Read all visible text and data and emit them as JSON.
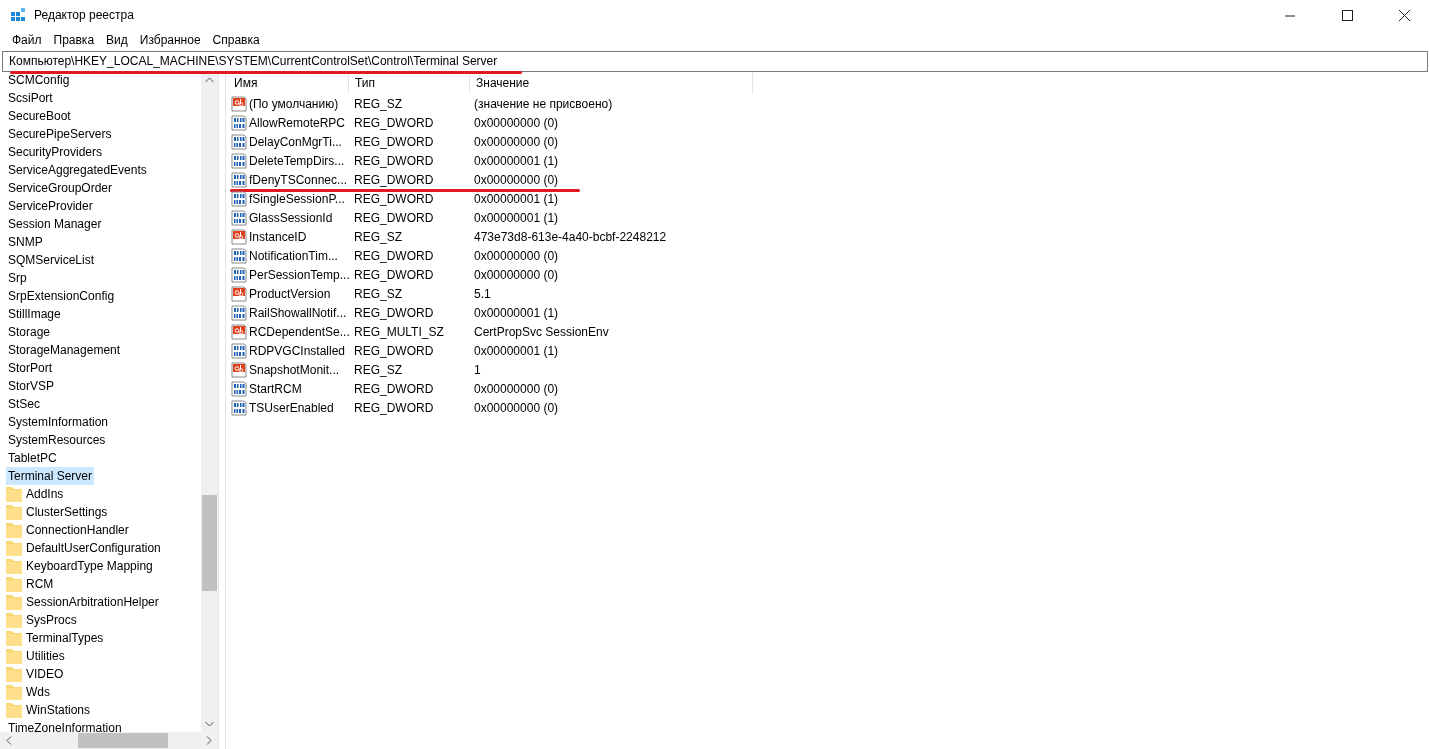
{
  "window": {
    "title": "Редактор реестра"
  },
  "menu": [
    "Файл",
    "Правка",
    "Вид",
    "Избранное",
    "Справка"
  ],
  "address": {
    "value": "Компьютер\\HKEY_LOCAL_MACHINE\\SYSTEM\\CurrentControlSet\\Control\\Terminal Server",
    "underlined": true
  },
  "tree": [
    {
      "label": "SCMConfig",
      "selected": false
    },
    {
      "label": "ScsiPort",
      "selected": false
    },
    {
      "label": "SecureBoot",
      "selected": false
    },
    {
      "label": "SecurePipeServers",
      "selected": false
    },
    {
      "label": "SecurityProviders",
      "selected": false
    },
    {
      "label": "ServiceAggregatedEvents",
      "selected": false
    },
    {
      "label": "ServiceGroupOrder",
      "selected": false
    },
    {
      "label": "ServiceProvider",
      "selected": false
    },
    {
      "label": "Session Manager",
      "selected": false
    },
    {
      "label": "SNMP",
      "selected": false
    },
    {
      "label": "SQMServiceList",
      "selected": false
    },
    {
      "label": "Srp",
      "selected": false
    },
    {
      "label": "SrpExtensionConfig",
      "selected": false
    },
    {
      "label": "StillImage",
      "selected": false
    },
    {
      "label": "Storage",
      "selected": false
    },
    {
      "label": "StorageManagement",
      "selected": false
    },
    {
      "label": "StorPort",
      "selected": false
    },
    {
      "label": "StorVSP",
      "selected": false
    },
    {
      "label": "StSec",
      "selected": false
    },
    {
      "label": "SystemInformation",
      "selected": false
    },
    {
      "label": "SystemResources",
      "selected": false
    },
    {
      "label": "TabletPC",
      "selected": false
    },
    {
      "label": "Terminal Server",
      "selected": true,
      "children": [
        {
          "label": "AddIns",
          "selected": false
        },
        {
          "label": "ClusterSettings",
          "selected": false
        },
        {
          "label": "ConnectionHandler",
          "selected": false
        },
        {
          "label": "DefaultUserConfiguration",
          "selected": false
        },
        {
          "label": "KeyboardType Mapping",
          "selected": false
        },
        {
          "label": "RCM",
          "selected": false
        },
        {
          "label": "SessionArbitrationHelper",
          "selected": false
        },
        {
          "label": "SysProcs",
          "selected": false
        },
        {
          "label": "TerminalTypes",
          "selected": false
        },
        {
          "label": "Utilities",
          "selected": false
        },
        {
          "label": "VIDEO",
          "selected": false
        },
        {
          "label": "Wds",
          "selected": false
        },
        {
          "label": "WinStations",
          "selected": false
        }
      ]
    },
    {
      "label": "TimeZoneInformation",
      "selected": false
    }
  ],
  "columns": [
    "Имя",
    "Тип",
    "Значение"
  ],
  "values": [
    {
      "kind": "string",
      "name": "(По умолчанию)",
      "type": "REG_SZ",
      "data": "(значение не присвоено)",
      "underlined": false
    },
    {
      "kind": "binary",
      "name": "AllowRemoteRPC",
      "type": "REG_DWORD",
      "data": "0x00000000 (0)",
      "underlined": false
    },
    {
      "kind": "binary",
      "name": "DelayConMgrTi...",
      "type": "REG_DWORD",
      "data": "0x00000000 (0)",
      "underlined": false
    },
    {
      "kind": "binary",
      "name": "DeleteTempDirs...",
      "type": "REG_DWORD",
      "data": "0x00000001 (1)",
      "underlined": false
    },
    {
      "kind": "binary",
      "name": "fDenyTSConnec...",
      "type": "REG_DWORD",
      "data": "0x00000000 (0)",
      "underlined": true
    },
    {
      "kind": "binary",
      "name": "fSingleSessionP...",
      "type": "REG_DWORD",
      "data": "0x00000001 (1)",
      "underlined": false
    },
    {
      "kind": "binary",
      "name": "GlassSessionId",
      "type": "REG_DWORD",
      "data": "0x00000001 (1)",
      "underlined": false
    },
    {
      "kind": "string",
      "name": "InstanceID",
      "type": "REG_SZ",
      "data": "473e73d8-613e-4a40-bcbf-2248212",
      "underlined": false
    },
    {
      "kind": "binary",
      "name": "NotificationTim...",
      "type": "REG_DWORD",
      "data": "0x00000000 (0)",
      "underlined": false
    },
    {
      "kind": "binary",
      "name": "PerSessionTemp...",
      "type": "REG_DWORD",
      "data": "0x00000000 (0)",
      "underlined": false
    },
    {
      "kind": "string",
      "name": "ProductVersion",
      "type": "REG_SZ",
      "data": "5.1",
      "underlined": false
    },
    {
      "kind": "binary",
      "name": "RailShowallNotif...",
      "type": "REG_DWORD",
      "data": "0x00000001 (1)",
      "underlined": false
    },
    {
      "kind": "string",
      "name": "RCDependentSe...",
      "type": "REG_MULTI_SZ",
      "data": "CertPropSvc SessionEnv",
      "underlined": false
    },
    {
      "kind": "binary",
      "name": "RDPVGCInstalled",
      "type": "REG_DWORD",
      "data": "0x00000001 (1)",
      "underlined": false
    },
    {
      "kind": "string",
      "name": "SnapshotMonit...",
      "type": "REG_SZ",
      "data": "1",
      "underlined": false
    },
    {
      "kind": "binary",
      "name": "StartRCM",
      "type": "REG_DWORD",
      "data": "0x00000000 (0)",
      "underlined": false
    },
    {
      "kind": "binary",
      "name": "TSUserEnabled",
      "type": "REG_DWORD",
      "data": "0x00000000 (0)",
      "underlined": false
    }
  ]
}
